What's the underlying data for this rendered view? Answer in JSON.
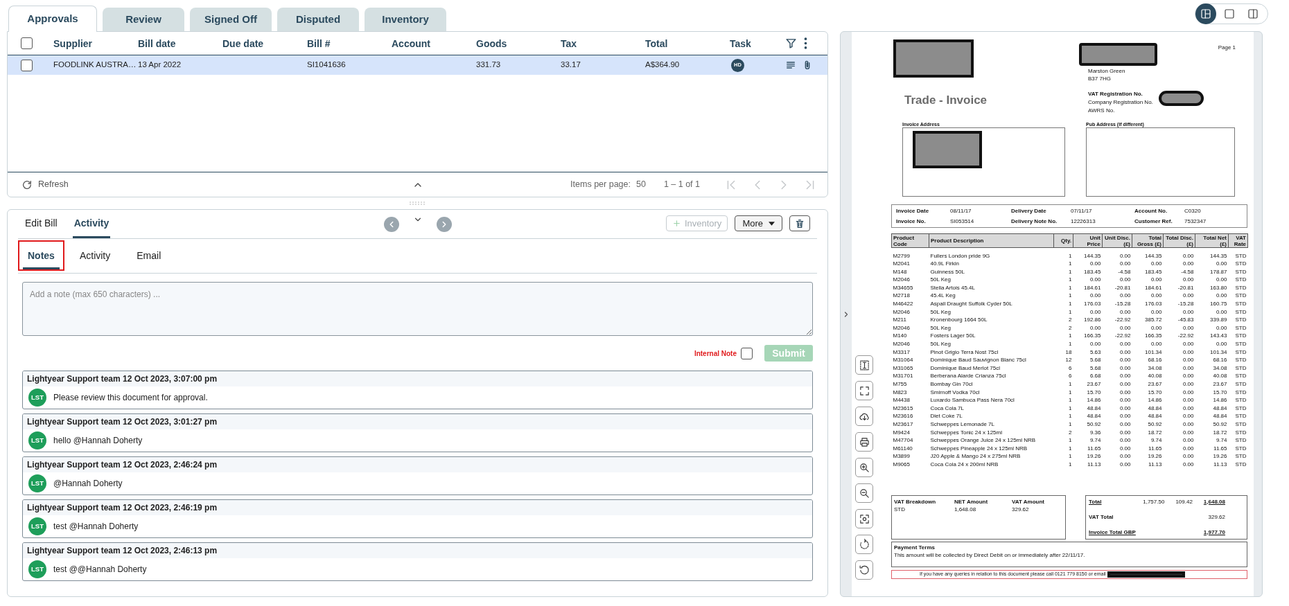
{
  "tabs": [
    {
      "label": "Approvals",
      "selected": true
    },
    {
      "label": "Review",
      "selected": false
    },
    {
      "label": "Signed Off",
      "selected": false
    },
    {
      "label": "Disputed",
      "selected": false
    },
    {
      "label": "Inventory",
      "selected": false
    }
  ],
  "bills_table": {
    "select_all_checked": false,
    "columns": [
      "Supplier",
      "Bill date",
      "Due date",
      "Bill #",
      "Account",
      "Goods",
      "Tax",
      "Total",
      "Task"
    ],
    "rows": [
      {
        "checked": false,
        "supplier": "FOODLINK AUSTRA…",
        "bill_date": "13 Apr 2022",
        "bill_no": "SI1041636",
        "goods": "331.73",
        "tax": "33.17",
        "total": "A$364.90",
        "task": "HD"
      }
    ],
    "footer": {
      "refresh": "Refresh",
      "items_per_page_label": "Items per page:",
      "items_per_page": "50",
      "range": "1 – 1 of 1"
    }
  },
  "detail": {
    "tabs": [
      {
        "label": "Edit Bill",
        "selected": false
      },
      {
        "label": "Activity",
        "selected": true
      }
    ],
    "inventory_button": {
      "label": "Inventory",
      "disabled": true
    },
    "more_button": "More"
  },
  "notes_tabs": [
    {
      "label": "Notes",
      "selected": true,
      "highlighted": true
    },
    {
      "label": "Activity",
      "selected": false,
      "highlighted": false
    },
    {
      "label": "Email",
      "selected": false,
      "highlighted": false
    }
  ],
  "note_input": {
    "placeholder": "Add a note (max 650 characters) ..."
  },
  "internal_note": {
    "label": "Internal Note",
    "checked": false
  },
  "submit": {
    "label": "Submit",
    "disabled": true
  },
  "notes": [
    {
      "header": "Lightyear Support team 12 Oct 2023, 3:07:00 pm",
      "avatar": "LST",
      "text": "Please review this document for approval."
    },
    {
      "header": "Lightyear Support team 12 Oct 2023, 3:01:27 pm",
      "avatar": "LST",
      "text": "hello @Hannah Doherty"
    },
    {
      "header": "Lightyear Support team 12 Oct 2023, 2:46:24 pm",
      "avatar": "LST",
      "text": "@Hannah Doherty"
    },
    {
      "header": "Lightyear Support team 12 Oct 2023, 2:46:19 pm",
      "avatar": "LST",
      "text": "test @Hannah Doherty"
    },
    {
      "header": "Lightyear Support team 12 Oct 2023, 2:46:13 pm",
      "avatar": "LST",
      "text": "test @@Hannah Doherty"
    }
  ],
  "view_modes": [
    {
      "kind": "split",
      "selected": true
    },
    {
      "kind": "single",
      "selected": false
    },
    {
      "kind": "columns",
      "selected": false
    }
  ],
  "invoice": {
    "page": "Page 1",
    "address_lines": [
      "Marston Green",
      "B37 7HG"
    ],
    "title": "Trade - Invoice",
    "registration_labels": [
      "VAT Registration No.",
      "Company Registration No.",
      "AWRS No."
    ],
    "invoice_address_label": "Invoice Address",
    "pub_address_label": "Pub Address (If different)",
    "details": [
      {
        "label": "Invoice Date",
        "value": "08/11/17"
      },
      {
        "label": "Delivery Date",
        "value": "07/11/17"
      },
      {
        "label": "Account No.",
        "value": "C0320"
      },
      {
        "label": "Invoice No.",
        "value": "SI053514"
      },
      {
        "label": "Delivery Note No.",
        "value": "12226313"
      },
      {
        "label": "Customer Ref.",
        "value": "7532347"
      }
    ],
    "columns": [
      "Product Code",
      "Product Description",
      "Qty.",
      "Unit Price",
      "Unit Disc. (£)",
      "Total Gross (£)",
      "Total Disc. (£)",
      "Total Net (£)",
      "VAT Rate"
    ],
    "lines": [
      [
        "M2799",
        "Fullers London pride 9G",
        "1",
        "144.35",
        "0.00",
        "144.35",
        "0.00",
        "144.35",
        "STD"
      ],
      [
        "M2041",
        "40.9L Firkin",
        "1",
        "0.00",
        "0.00",
        "0.00",
        "0.00",
        "0.00",
        "STD"
      ],
      [
        "M148",
        "Guinness 50L",
        "1",
        "183.45",
        "-4.58",
        "183.45",
        "-4.58",
        "178.87",
        "STD"
      ],
      [
        "M2046",
        "50L Keg",
        "1",
        "0.00",
        "0.00",
        "0.00",
        "0.00",
        "0.00",
        "STD"
      ],
      [
        "M34655",
        "Stella Artois 45.4L",
        "1",
        "184.61",
        "-20.81",
        "184.61",
        "-20.81",
        "163.80",
        "STD"
      ],
      [
        "M2718",
        "45.4L Keg",
        "1",
        "0.00",
        "0.00",
        "0.00",
        "0.00",
        "0.00",
        "STD"
      ],
      [
        "M46422",
        "Aspall Draught Suffolk Cyder 50L",
        "1",
        "176.03",
        "-15.28",
        "176.03",
        "-15.28",
        "160.75",
        "STD"
      ],
      [
        "M2046",
        "50L Keg",
        "1",
        "0.00",
        "0.00",
        "0.00",
        "0.00",
        "0.00",
        "STD"
      ],
      [
        "M211",
        "Kronenbourg 1664 50L",
        "2",
        "192.86",
        "-22.92",
        "385.72",
        "-45.83",
        "339.89",
        "STD"
      ],
      [
        "M2046",
        "50L Keg",
        "2",
        "0.00",
        "0.00",
        "0.00",
        "0.00",
        "0.00",
        "STD"
      ],
      [
        "M140",
        "Fosters Lager 50L",
        "1",
        "166.35",
        "-22.92",
        "166.35",
        "-22.92",
        "143.43",
        "STD"
      ],
      [
        "M2046",
        "50L Keg",
        "1",
        "0.00",
        "0.00",
        "0.00",
        "0.00",
        "0.00",
        "STD"
      ],
      [
        "M3317",
        "Pinot Grigio Terra Nost 75cl",
        "18",
        "5.63",
        "0.00",
        "101.34",
        "0.00",
        "101.34",
        "STD"
      ],
      [
        "M31064",
        "Dominique Baud Sauvignon Blanc 75cl",
        "12",
        "5.68",
        "0.00",
        "68.16",
        "0.00",
        "68.16",
        "STD"
      ],
      [
        "M31065",
        "Dominique Baud Merlot 75cl",
        "6",
        "5.68",
        "0.00",
        "34.08",
        "0.00",
        "34.08",
        "STD"
      ],
      [
        "M31701",
        "Berberana Alarde Crianza 75cl",
        "6",
        "6.68",
        "0.00",
        "40.08",
        "0.00",
        "40.08",
        "STD"
      ],
      [
        "M755",
        "Bombay Gin 70cl",
        "1",
        "23.67",
        "0.00",
        "23.67",
        "0.00",
        "23.67",
        "STD"
      ],
      [
        "M823",
        "Smirnoff Vodka 70cl",
        "1",
        "15.70",
        "0.00",
        "15.70",
        "0.00",
        "15.70",
        "STD"
      ],
      [
        "M4438",
        "Luxardo Sambuca Pass Nera 70cl",
        "1",
        "14.86",
        "0.00",
        "14.86",
        "0.00",
        "14.86",
        "STD"
      ],
      [
        "M23615",
        "Coca Cola 7L",
        "1",
        "48.84",
        "0.00",
        "48.84",
        "0.00",
        "48.84",
        "STD"
      ],
      [
        "M23616",
        "Diet Coke 7L",
        "1",
        "48.84",
        "0.00",
        "48.84",
        "0.00",
        "48.84",
        "STD"
      ],
      [
        "M23617",
        "Schweppes Lemonade 7L",
        "1",
        "50.92",
        "0.00",
        "50.92",
        "0.00",
        "50.92",
        "STD"
      ],
      [
        "M9424",
        "Schweppes Tonic 24 x 125ml",
        "2",
        "9.36",
        "0.00",
        "18.72",
        "0.00",
        "18.72",
        "STD"
      ],
      [
        "M47704",
        "Schweppes Orange Juice 24 x 125ml NRB",
        "1",
        "9.74",
        "0.00",
        "9.74",
        "0.00",
        "9.74",
        "STD"
      ],
      [
        "M61140",
        "Schweppes Pineapple 24 x 125ml NRB",
        "1",
        "11.65",
        "0.00",
        "11.65",
        "0.00",
        "11.65",
        "STD"
      ],
      [
        "M3899",
        "J20 Apple & Mango 24 x 275ml NRB",
        "1",
        "19.26",
        "0.00",
        "19.26",
        "0.00",
        "19.26",
        "STD"
      ],
      [
        "M9065",
        "Coca Cola 24 x 200ml NRB",
        "1",
        "11.13",
        "0.00",
        "11.13",
        "0.00",
        "11.13",
        "STD"
      ]
    ],
    "vat_breakdown": {
      "headers": [
        "VAT Breakdown",
        "NET Amount",
        "VAT Amount"
      ],
      "row": [
        "STD",
        "1,648.08",
        "329.62"
      ]
    },
    "totals": [
      {
        "label": "Total",
        "emphasis": true,
        "values": [
          "1,757.50",
          "109.42",
          "1,648.08"
        ]
      },
      {
        "label": "VAT Total",
        "emphasis": false,
        "values": [
          "329.62"
        ]
      },
      {
        "label": "Invoice Total GBP",
        "emphasis": true,
        "values": [
          "1,977.70"
        ]
      }
    ],
    "payment_terms": {
      "title": "Payment Terms",
      "text": "This amount will be collected by Direct Debit on or immediately after 22/11/17."
    },
    "footer_note": "If you have any queries in relation to this document please call 0121 779 8150 or email"
  }
}
